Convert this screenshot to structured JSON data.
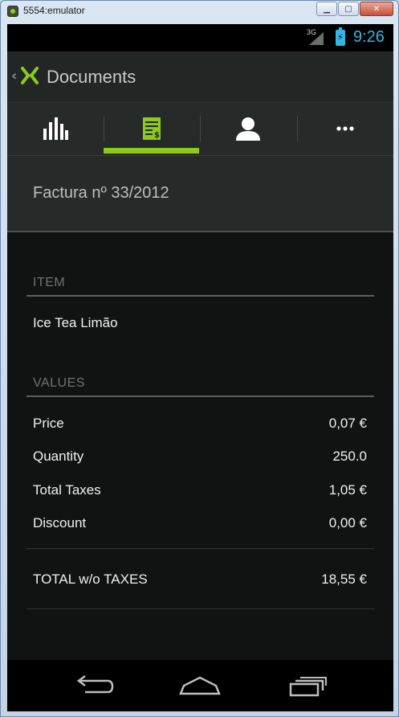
{
  "window": {
    "title": "5554:emulator"
  },
  "status_bar": {
    "network": "3G",
    "time": "9:26"
  },
  "action_bar": {
    "title": "Documents"
  },
  "tabs": [
    {
      "icon": "bar-chart-icon",
      "selected": false
    },
    {
      "icon": "invoice-icon",
      "selected": true
    },
    {
      "icon": "person-icon",
      "selected": false
    },
    {
      "icon": "more-icon",
      "selected": false
    }
  ],
  "document": {
    "title": "Factura nº 33/2012"
  },
  "item_section": {
    "label": "ITEM",
    "name": "Ice Tea Limão"
  },
  "values_section": {
    "label": "VALUES",
    "rows": [
      {
        "label": "Price",
        "value": "0,07 €"
      },
      {
        "label": "Quantity",
        "value": "250.0"
      },
      {
        "label": "Total Taxes",
        "value": "1,05 €"
      },
      {
        "label": "Discount",
        "value": "0,00 €"
      }
    ],
    "total": {
      "label": "TOTAL w/o TAXES",
      "value": "18,55 €"
    }
  },
  "colors": {
    "accent": "#8ec91b",
    "status_time": "#33b5e5"
  }
}
